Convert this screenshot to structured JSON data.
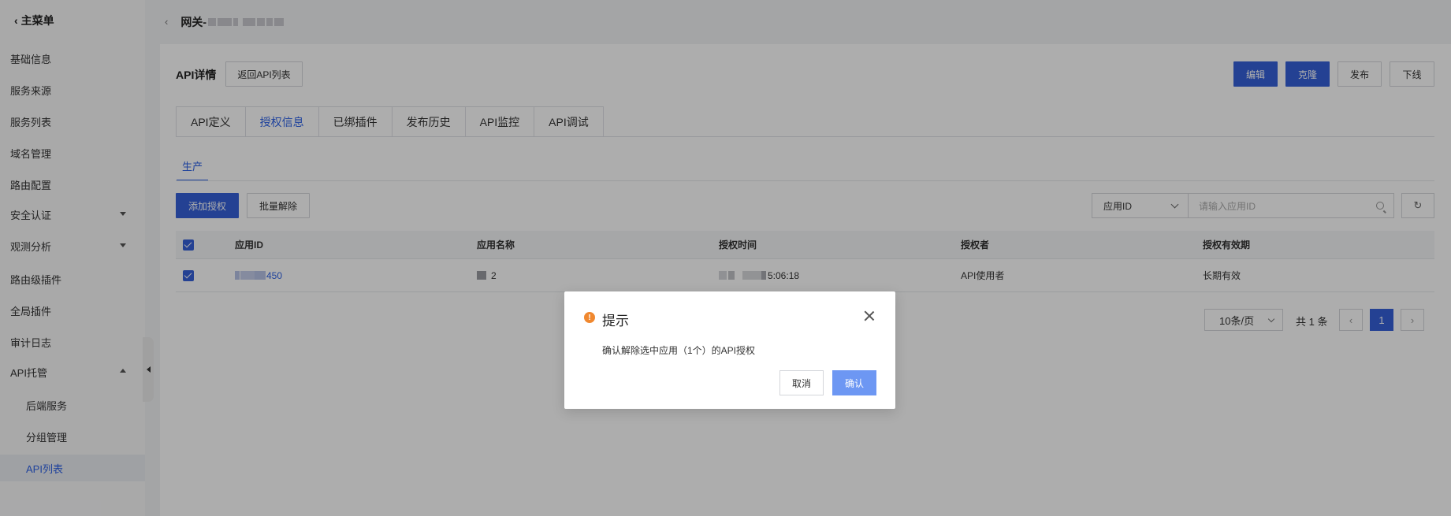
{
  "sidebar": {
    "back_label": "主菜单",
    "items": [
      {
        "label": "基础信息"
      },
      {
        "label": "服务来源"
      },
      {
        "label": "服务列表"
      },
      {
        "label": "域名管理"
      },
      {
        "label": "路由配置"
      },
      {
        "label": "安全认证",
        "caret": "down"
      },
      {
        "label": "观测分析",
        "caret": "down"
      },
      {
        "label": "路由级插件"
      },
      {
        "label": "全局插件"
      },
      {
        "label": "审计日志"
      },
      {
        "label": "API托管",
        "caret": "up"
      },
      {
        "label": "后端服务",
        "sub": true
      },
      {
        "label": "分组管理",
        "sub": true
      },
      {
        "label": "API列表",
        "sub": true,
        "active": true
      }
    ]
  },
  "header": {
    "back_icon": "chevron-left-icon",
    "breadcrumb_prefix": "网关-"
  },
  "detail": {
    "title": "API详情",
    "back_to_list": "返回API列表",
    "actions": {
      "edit": "编辑",
      "clone": "克隆",
      "publish": "发布",
      "offline": "下线"
    }
  },
  "tabs": [
    {
      "label": "API定义"
    },
    {
      "label": "授权信息",
      "active": true
    },
    {
      "label": "已绑插件"
    },
    {
      "label": "发布历史"
    },
    {
      "label": "API监控"
    },
    {
      "label": "API调试"
    }
  ],
  "subtab": {
    "label": "生产"
  },
  "toolbar": {
    "add_auth": "添加授权",
    "batch_remove": "批量解除",
    "filter_field": "应用ID",
    "search_placeholder": "请输入应用ID",
    "refresh_icon": "refresh-icon"
  },
  "table": {
    "columns": [
      "应用ID",
      "应用名称",
      "授权时间",
      "授权者",
      "授权有效期"
    ],
    "rows": [
      {
        "selected": true,
        "app_id_suffix": "450",
        "app_name_suffix": "2",
        "auth_time_suffix": "5:06:18",
        "authorizer": "API使用者",
        "validity": "长期有效"
      }
    ]
  },
  "pagination": {
    "page_size": "10条/页",
    "total": "共 1 条",
    "current_page": "1",
    "prev_icon": "chevron-left-icon",
    "next_icon": "chevron-right-icon"
  },
  "modal": {
    "title": "提示",
    "message": "确认解除选中应用（1个）的API授权",
    "cancel": "取消",
    "confirm": "确认",
    "warn_glyph": "!"
  },
  "colors": {
    "primary": "#3561d9",
    "link": "#2e62e6",
    "warning": "#f0882f",
    "confirm_light": "#6d97f3"
  }
}
